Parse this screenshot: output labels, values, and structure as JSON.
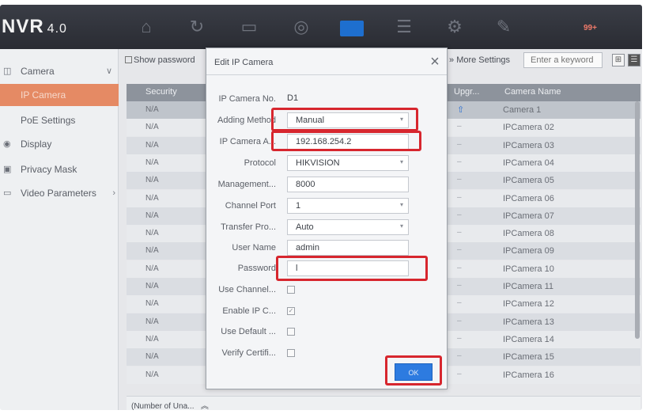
{
  "app": {
    "title": "NVR",
    "version": "4.0"
  },
  "topbar": {
    "badge": "99+"
  },
  "sidebar": {
    "items": [
      {
        "label": "Camera"
      },
      {
        "label": "IP Camera"
      },
      {
        "label": "PoE Settings"
      },
      {
        "label": "Display"
      },
      {
        "label": "Privacy Mask"
      },
      {
        "label": "Video Parameters"
      }
    ]
  },
  "toolbar": {
    "show_password": "Show password",
    "more_settings": "More Settings",
    "search_placeholder": "Enter a keyword"
  },
  "table": {
    "headers": {
      "security": "Security",
      "upgrade": "Upgr...",
      "name": "Camera Name"
    },
    "rows": [
      {
        "security": "N/A",
        "upgrade": "⇧",
        "name": "Camera 1"
      },
      {
        "security": "N/A",
        "upgrade": "–",
        "name": "IPCamera 02"
      },
      {
        "security": "N/A",
        "upgrade": "–",
        "name": "IPCamera 03"
      },
      {
        "security": "N/A",
        "upgrade": "–",
        "name": "IPCamera 04"
      },
      {
        "security": "N/A",
        "upgrade": "–",
        "name": "IPCamera 05"
      },
      {
        "security": "N/A",
        "upgrade": "–",
        "name": "IPCamera 06"
      },
      {
        "security": "N/A",
        "upgrade": "–",
        "name": "IPCamera 07"
      },
      {
        "security": "N/A",
        "upgrade": "–",
        "name": "IPCamera 08"
      },
      {
        "security": "N/A",
        "upgrade": "–",
        "name": "IPCamera 09"
      },
      {
        "security": "N/A",
        "upgrade": "–",
        "name": "IPCamera 10"
      },
      {
        "security": "N/A",
        "upgrade": "–",
        "name": "IPCamera 11"
      },
      {
        "security": "N/A",
        "upgrade": "–",
        "name": "IPCamera 12"
      },
      {
        "security": "N/A",
        "upgrade": "–",
        "name": "IPCamera 13"
      },
      {
        "security": "N/A",
        "upgrade": "–",
        "name": "IPCamera 14"
      },
      {
        "security": "N/A",
        "upgrade": "–",
        "name": "IPCamera 15"
      },
      {
        "security": "N/A",
        "upgrade": "–",
        "name": "IPCamera 16"
      }
    ],
    "footer": "(Number of Una..."
  },
  "dialog": {
    "title": "Edit IP Camera",
    "fields": {
      "ip_camera_no": {
        "label": "IP Camera No.",
        "value": "D1"
      },
      "adding_method": {
        "label": "Adding Method",
        "value": "Manual"
      },
      "ip_address": {
        "label": "IP Camera A...",
        "value": "192.168.254.2"
      },
      "protocol": {
        "label": "Protocol",
        "value": "HIKVISION"
      },
      "management_port": {
        "label": "Management...",
        "value": "8000"
      },
      "channel_port": {
        "label": "Channel Port",
        "value": "1"
      },
      "transfer_protocol": {
        "label": "Transfer Pro...",
        "value": "Auto"
      },
      "user_name": {
        "label": "User Name",
        "value": "admin"
      },
      "password": {
        "label": "Password",
        "value": "l"
      },
      "use_channel": {
        "label": "Use Channel...",
        "checked": false
      },
      "enable_ip": {
        "label": "Enable IP C...",
        "checked": true
      },
      "use_default": {
        "label": "Use Default ...",
        "checked": false
      },
      "verify_cert": {
        "label": "Verify Certifi...",
        "checked": false
      }
    },
    "ok_label": "OK"
  },
  "colors": {
    "highlight": "#d7262e",
    "accent": "#2d7be0",
    "sidebar_active": "#e58a64"
  }
}
